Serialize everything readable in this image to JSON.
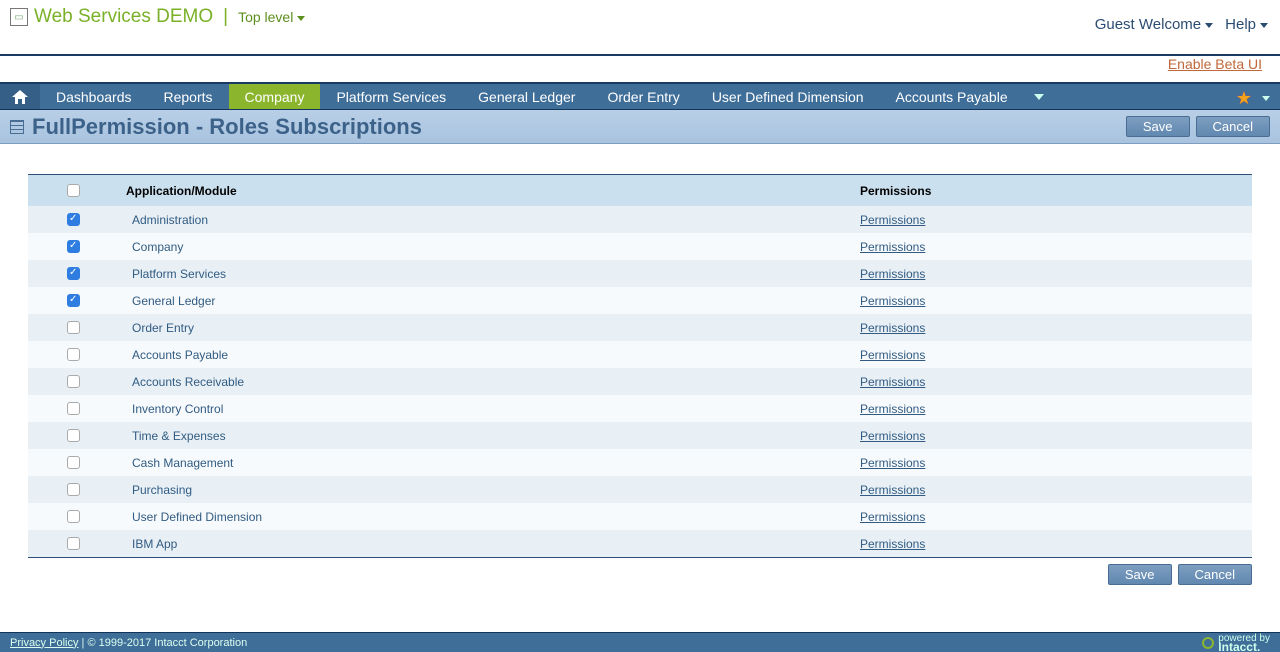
{
  "header": {
    "brand": "Web Services DEMO",
    "pipe": "|",
    "level": "Top level",
    "guest": "Guest Welcome",
    "help": "Help",
    "beta": "Enable Beta UI"
  },
  "nav": {
    "items": [
      "Dashboards",
      "Reports",
      "Company",
      "Platform Services",
      "General Ledger",
      "Order Entry",
      "User Defined Dimension",
      "Accounts Payable"
    ],
    "active": "Company"
  },
  "sub": {
    "title": "FullPermission - Roles Subscriptions",
    "save": "Save",
    "cancel": "Cancel"
  },
  "table": {
    "head_app": "Application/Module",
    "head_perm": "Permissions",
    "link": "Permissions",
    "rows": [
      {
        "name": "Administration",
        "checked": true
      },
      {
        "name": "Company",
        "checked": true
      },
      {
        "name": "Platform Services",
        "checked": true
      },
      {
        "name": "General Ledger",
        "checked": true
      },
      {
        "name": "Order Entry",
        "checked": false
      },
      {
        "name": "Accounts Payable",
        "checked": false
      },
      {
        "name": "Accounts Receivable",
        "checked": false
      },
      {
        "name": "Inventory Control",
        "checked": false
      },
      {
        "name": "Time & Expenses",
        "checked": false
      },
      {
        "name": "Cash Management",
        "checked": false
      },
      {
        "name": "Purchasing",
        "checked": false
      },
      {
        "name": "User Defined Dimension",
        "checked": false
      },
      {
        "name": "IBM App",
        "checked": false
      }
    ]
  },
  "footer": {
    "privacy": "Privacy Policy",
    "copy": "| © 1999-2017  Intacct Corporation",
    "powered": "powered by",
    "brand": "Intacct."
  }
}
